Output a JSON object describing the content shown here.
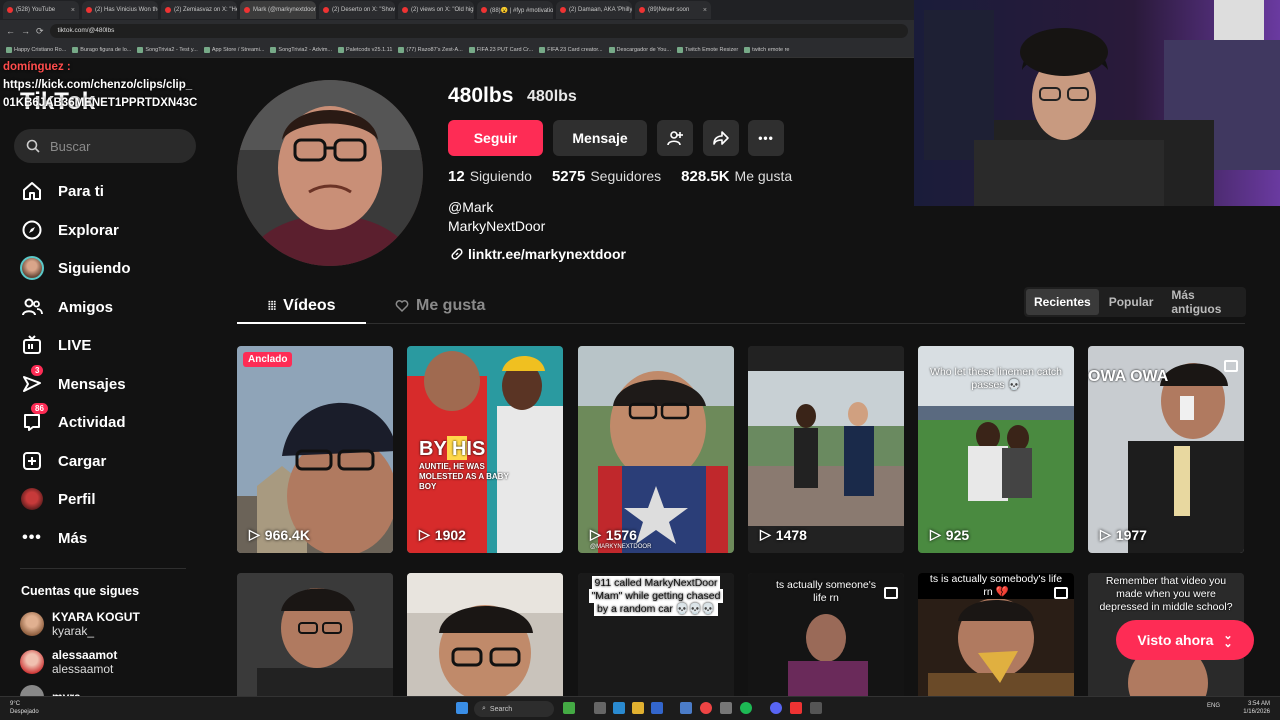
{
  "browser": {
    "tabs": [
      "(528) YouTube",
      "(2) Has Vinicius Won the",
      "(2) Zemiasvaz on X: \"Hey",
      "Mark (@markynextdoor)",
      "(2) Deserto on X: \"Showi",
      "(2) views on X: \"Old high",
      "(88)😮 | #fyp #motivatio",
      "(2) Damaan, AKA 'Philly's",
      "(89)Never soon"
    ],
    "url": "tiktok.com/@480lbs",
    "bookmarks": [
      "Happy Cristiano Ro...",
      "Burago figura de lo...",
      "SongTrivia2 - Test y...",
      "App Store / Streami...",
      "SongTrivia2 - Advim...",
      "Paletcods v25.1.11",
      "(77) Razo87's Zest-A...",
      "FIFA 23 PUT Card Cr...",
      "FIFA 23 Card creator...",
      "Descargador de You...",
      "Twitch Emote Resizer",
      "twitch emote re"
    ]
  },
  "overlay": {
    "user": "domínguez :",
    "line1": "https://kick.com/chenzo/clips/clip_",
    "line2": "01KB6JAB36MENET1PPRTDXN43C"
  },
  "sidebar": {
    "logo": "TikTok",
    "search_placeholder": "Buscar",
    "items": [
      {
        "label": "Para ti",
        "icon": "home-icon"
      },
      {
        "label": "Explorar",
        "icon": "compass-icon"
      },
      {
        "label": "Siguiendo",
        "icon": "following-avatar"
      },
      {
        "label": "Amigos",
        "icon": "friends-icon"
      },
      {
        "label": "LIVE",
        "icon": "live-tv-icon"
      },
      {
        "label": "Mensajes",
        "icon": "send-icon",
        "badge": "3"
      },
      {
        "label": "Actividad",
        "icon": "inbox-icon",
        "badge": "86"
      },
      {
        "label": "Cargar",
        "icon": "upload-plus-icon"
      },
      {
        "label": "Perfil",
        "icon": "profile-avatar"
      },
      {
        "label": "Más",
        "icon": "more-dots-icon"
      }
    ],
    "following_header": "Cuentas que sigues",
    "following": [
      {
        "name": "KYARA KOGUT",
        "handle": "kyarak_"
      },
      {
        "name": "alessaamot",
        "handle": "alessaamot"
      },
      {
        "name": "myra",
        "handle": ""
      }
    ]
  },
  "profile": {
    "username": "480lbs",
    "nickname": "480lbs",
    "follow_label": "Seguir",
    "message_label": "Mensaje",
    "stats": [
      {
        "value": "12",
        "label": "Siguiendo"
      },
      {
        "value": "5275",
        "label": "Seguidores"
      },
      {
        "value": "828.5K",
        "label": "Me gusta"
      }
    ],
    "bio_line1": "@Mark",
    "bio_line2": "MarkyNextDoor",
    "link": "linktr.ee/markynextdoor"
  },
  "tabs": {
    "videos": "Vídeos",
    "likes": "Me gusta",
    "sort": [
      "Recientes",
      "Popular",
      "Más antiguos"
    ]
  },
  "videos_row1": [
    {
      "views": "966.4K",
      "pinned": "Anclado",
      "caption": ""
    },
    {
      "views": "1902",
      "pinned": "",
      "caption": "BY HIS"
    },
    {
      "views": "1576",
      "pinned": "",
      "caption": ""
    },
    {
      "views": "1478",
      "pinned": "",
      "caption": ""
    },
    {
      "views": "925",
      "pinned": "",
      "caption": "Who let these linemen catch passes 💀"
    },
    {
      "views": "1977",
      "pinned": "",
      "caption": "OWA OWA"
    }
  ],
  "videos_row2": [
    {
      "caption": ""
    },
    {
      "caption": ""
    },
    {
      "caption": "911 called MarkyNextDoor \"Mam\" while getting chased by a random car 💀💀💀"
    },
    {
      "caption": "ts actually someone's life rn"
    },
    {
      "caption": "ts is actually somebody's life rn 💔"
    },
    {
      "caption": "Remember that video you made when you were depressed in middle school?"
    }
  ],
  "card_extra": {
    "subtext": "AUNTIE, HE WAS MOLESTED AS A BABY BOY",
    "watermark": "@MARKYNEXTDOOR"
  },
  "visto_label": "Visto ahora",
  "taskbar": {
    "temp": "9°C",
    "weather": "Despejado",
    "search": "Search",
    "lang": "ENG",
    "time": "3:54 AM",
    "date": "1/16/2026"
  }
}
